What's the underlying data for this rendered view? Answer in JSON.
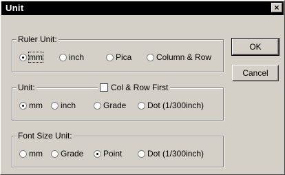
{
  "window": {
    "title": "Unit",
    "close_label": "×"
  },
  "buttons": {
    "ok": "OK",
    "cancel": "Cancel"
  },
  "ruler_unit": {
    "legend": "Ruler Unit:",
    "options": [
      "mm",
      "inch",
      "Pica",
      "Column & Row"
    ],
    "selected": "mm"
  },
  "unit": {
    "legend": "Unit:",
    "checkbox_label": "Col & Row First",
    "checkbox_checked": false,
    "options": [
      "mm",
      "inch",
      "Grade",
      "Dot (1/300inch)"
    ],
    "selected": "mm"
  },
  "font_size_unit": {
    "legend": "Font Size Unit:",
    "options": [
      "mm",
      "Grade",
      "Point",
      "Dot (1/300inch)"
    ],
    "selected": "Point"
  }
}
